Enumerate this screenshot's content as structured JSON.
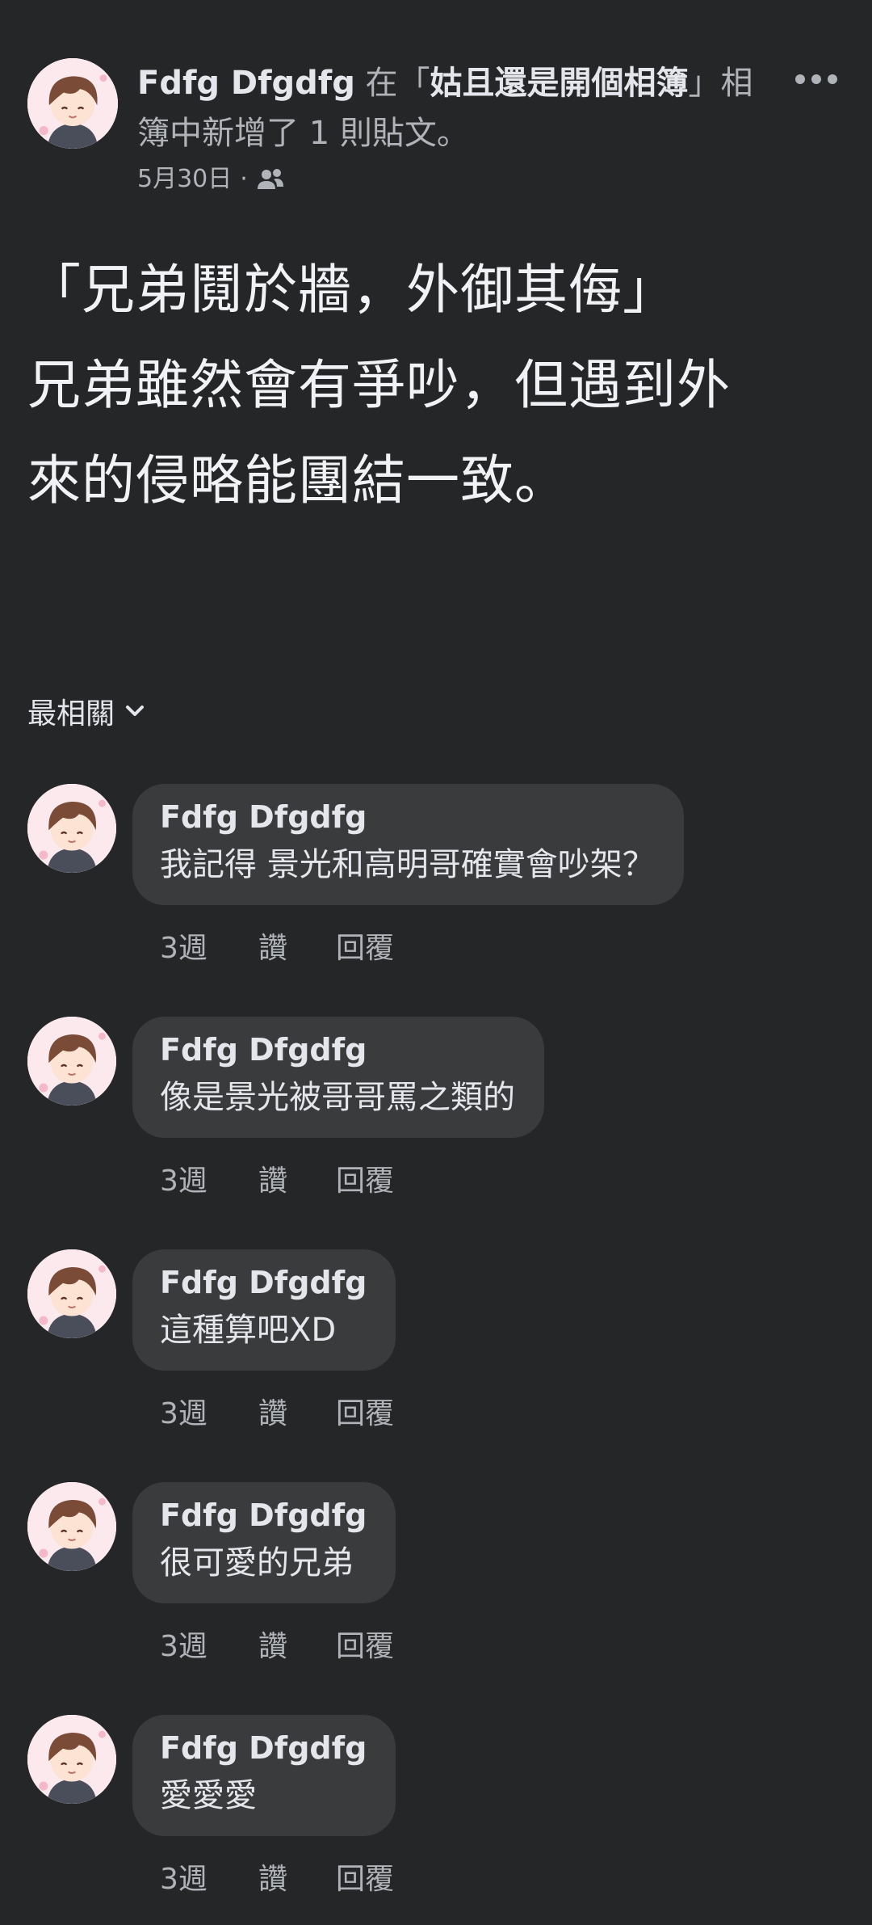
{
  "post": {
    "author": "Fdfg Dfgdfg",
    "in_word": " 在「",
    "album": "姑且還是開個相簿",
    "action_tail": "」相簿中新增了 1 則貼文。",
    "date": "5月30日",
    "meta_sep": "·",
    "audience_icon": "friends-icon",
    "body_lines": [
      "「兄弟鬩於牆，外御其侮」",
      "兄弟雖然會有爭吵，但遇到外",
      "來的侵略能團結一致。"
    ]
  },
  "sort": {
    "label": "最相關",
    "icon": "chevron-down-icon"
  },
  "comments": [
    {
      "name": "Fdfg Dfgdfg",
      "text": "我記得 景光和高明哥確實會吵架？",
      "time": "3週",
      "like": "讚",
      "reply": "回覆"
    },
    {
      "name": "Fdfg Dfgdfg",
      "text": "像是景光被哥哥罵之類的",
      "time": "3週",
      "like": "讚",
      "reply": "回覆"
    },
    {
      "name": "Fdfg Dfgdfg",
      "text": "這種算吧XD",
      "time": "3週",
      "like": "讚",
      "reply": "回覆"
    },
    {
      "name": "Fdfg Dfgdfg",
      "text": "很可愛的兄弟",
      "time": "3週",
      "like": "讚",
      "reply": "回覆"
    },
    {
      "name": "Fdfg Dfgdfg",
      "text": "愛愛愛",
      "time": "3週",
      "like": "讚",
      "reply": "回覆"
    }
  ],
  "colors": {
    "background": "#252628",
    "bubble": "#3a3b3c",
    "primary_text": "#e4e6eb",
    "secondary_text": "#b0b3b8"
  }
}
